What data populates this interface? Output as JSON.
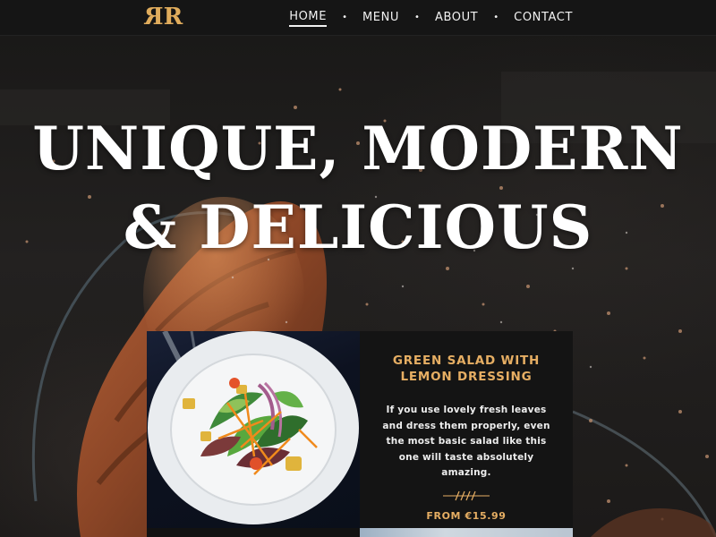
{
  "brand": {
    "logo_left": "R",
    "logo_right": "R"
  },
  "nav": {
    "items": [
      {
        "label": "HOME",
        "active": true
      },
      {
        "label": "MENU",
        "active": false
      },
      {
        "label": "ABOUT",
        "active": false
      },
      {
        "label": "CONTACT",
        "active": false
      }
    ],
    "separator": "•"
  },
  "hero": {
    "title_line1": "UNIQUE, MODERN",
    "title_line2": "& DELICIOUS"
  },
  "featured": {
    "title": "GREEN SALAD WITH LEMON DRESSING",
    "description": "If you use lovely fresh leaves and dress them properly, even the most basic salad like this one will taste absolutely amazing.",
    "price": "FROM €15.99"
  },
  "colors": {
    "accent": "#e6ae63",
    "navbar": "#151515",
    "card": "#141414",
    "text": "#ffffff"
  }
}
